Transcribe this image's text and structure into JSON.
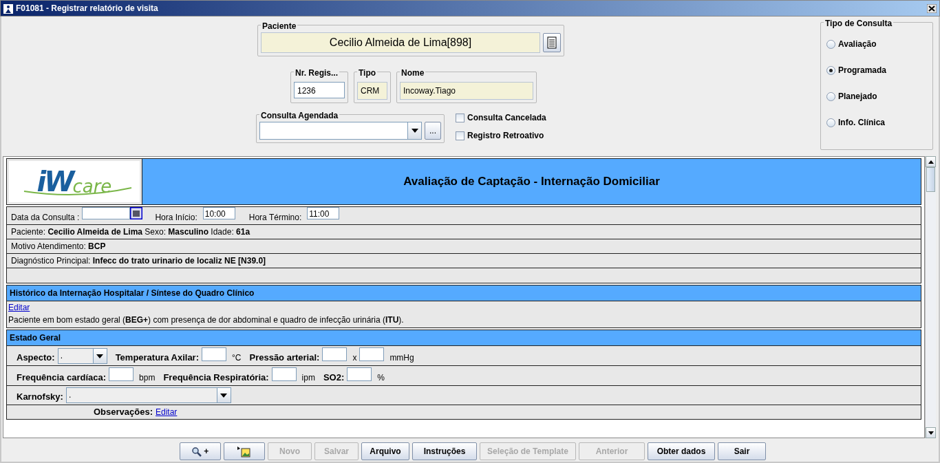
{
  "window": {
    "title": "F01081 - Registrar relatório de visita"
  },
  "paciente": {
    "label": "Paciente",
    "value": "Cecilio Almeida de Lima[898]"
  },
  "registro": [
    {
      "label": "Nr. Regis...",
      "value": "1236",
      "readonly": false
    },
    {
      "label": "Tipo",
      "value": "CRM",
      "readonly": true
    },
    {
      "label": "Nome",
      "value": "Incoway.Tiago",
      "readonly": true
    }
  ],
  "consulta_agendada": {
    "label": "Consulta Agendada",
    "more": "..."
  },
  "checkboxes": [
    {
      "label": "Consulta Cancelada",
      "checked": false
    },
    {
      "label": "Registro Retroativo",
      "checked": false
    }
  ],
  "tipo_consulta": {
    "title": "Tipo de Consulta",
    "options": [
      {
        "label": "Avaliação",
        "selected": false
      },
      {
        "label": "Programada",
        "selected": true
      },
      {
        "label": "Planejado",
        "selected": false
      },
      {
        "label": "Info. Clínica",
        "selected": false
      }
    ]
  },
  "document": {
    "logo": [
      "iW",
      "care"
    ],
    "title": "Avaliação de Captação - Internação Domiciliar",
    "date_row": {
      "date_label": "Data da Consulta :",
      "start_label": "Hora Início:",
      "start_value": "10:00",
      "end_label": "Hora Término:",
      "end_value": "11:00"
    },
    "info_rows": [
      "Paciente: **Cecilio Almeida de Lima** Sexo: **Masculino** Idade: **61a**",
      "Motivo Atendimento: **BCP**",
      "Diagnóstico Principal: **Infecc do trato urinario de localiz NE [N39.0]**"
    ],
    "sections": [
      {
        "title": "Histórico da Internação Hospitalar / Síntese do Quadro Clínico",
        "kind": "text",
        "link": "Editar",
        "text": "Paciente em bom estado geral (**BEG+**) com presença de dor abdominal e quadro de infecção urinária (**ITU**)."
      },
      {
        "title": "Estado Geral",
        "kind": "form",
        "rows": [
          {
            "items": [
              {
                "kind": "label",
                "text": "Aspecto:"
              },
              {
                "kind": "combo",
                "value": ".",
                "wide": false
              },
              {
                "kind": "label",
                "text": "Temperatura Axilar:"
              },
              {
                "kind": "field"
              },
              {
                "kind": "unit",
                "text": "°C"
              },
              {
                "kind": "label",
                "text": "Pressão arterial:"
              },
              {
                "kind": "field"
              },
              {
                "kind": "unit",
                "text": "x"
              },
              {
                "kind": "field"
              },
              {
                "kind": "unit",
                "text": "mmHg"
              }
            ]
          },
          {
            "items": [
              {
                "kind": "label",
                "text": "Frequência cardíaca:"
              },
              {
                "kind": "field"
              },
              {
                "kind": "unit",
                "text": "bpm"
              },
              {
                "kind": "label",
                "text": "Frequência Respiratória:"
              },
              {
                "kind": "field"
              },
              {
                "kind": "unit",
                "text": "ipm"
              },
              {
                "kind": "label",
                "text": "SO2:"
              },
              {
                "kind": "field"
              },
              {
                "kind": "unit",
                "text": "%"
              }
            ]
          },
          {
            "items": [
              {
                "kind": "label",
                "text": "Karnofsky:"
              },
              {
                "kind": "combo",
                "value": ".",
                "wide": true
              }
            ]
          },
          {
            "items": [
              {
                "kind": "label",
                "text": "Observações:"
              },
              {
                "kind": "link",
                "text": "Editar"
              }
            ]
          }
        ]
      }
    ]
  },
  "buttons": [
    {
      "kind": "zoom",
      "label": "+",
      "disabled": false
    },
    {
      "kind": "image",
      "disabled": false
    },
    {
      "kind": "text",
      "label": "Novo",
      "disabled": true
    },
    {
      "kind": "text",
      "label": "Salvar",
      "disabled": true
    },
    {
      "kind": "text",
      "label": "Arquivo",
      "disabled": false
    },
    {
      "kind": "text",
      "label": "Instruções",
      "disabled": false
    },
    {
      "kind": "text",
      "label": "Seleção de Template",
      "disabled": true
    },
    {
      "kind": "text",
      "label": "Anterior",
      "disabled": true
    },
    {
      "kind": "text",
      "label": "Obter dados",
      "disabled": false
    },
    {
      "kind": "text",
      "label": "Sair",
      "disabled": false
    }
  ]
}
